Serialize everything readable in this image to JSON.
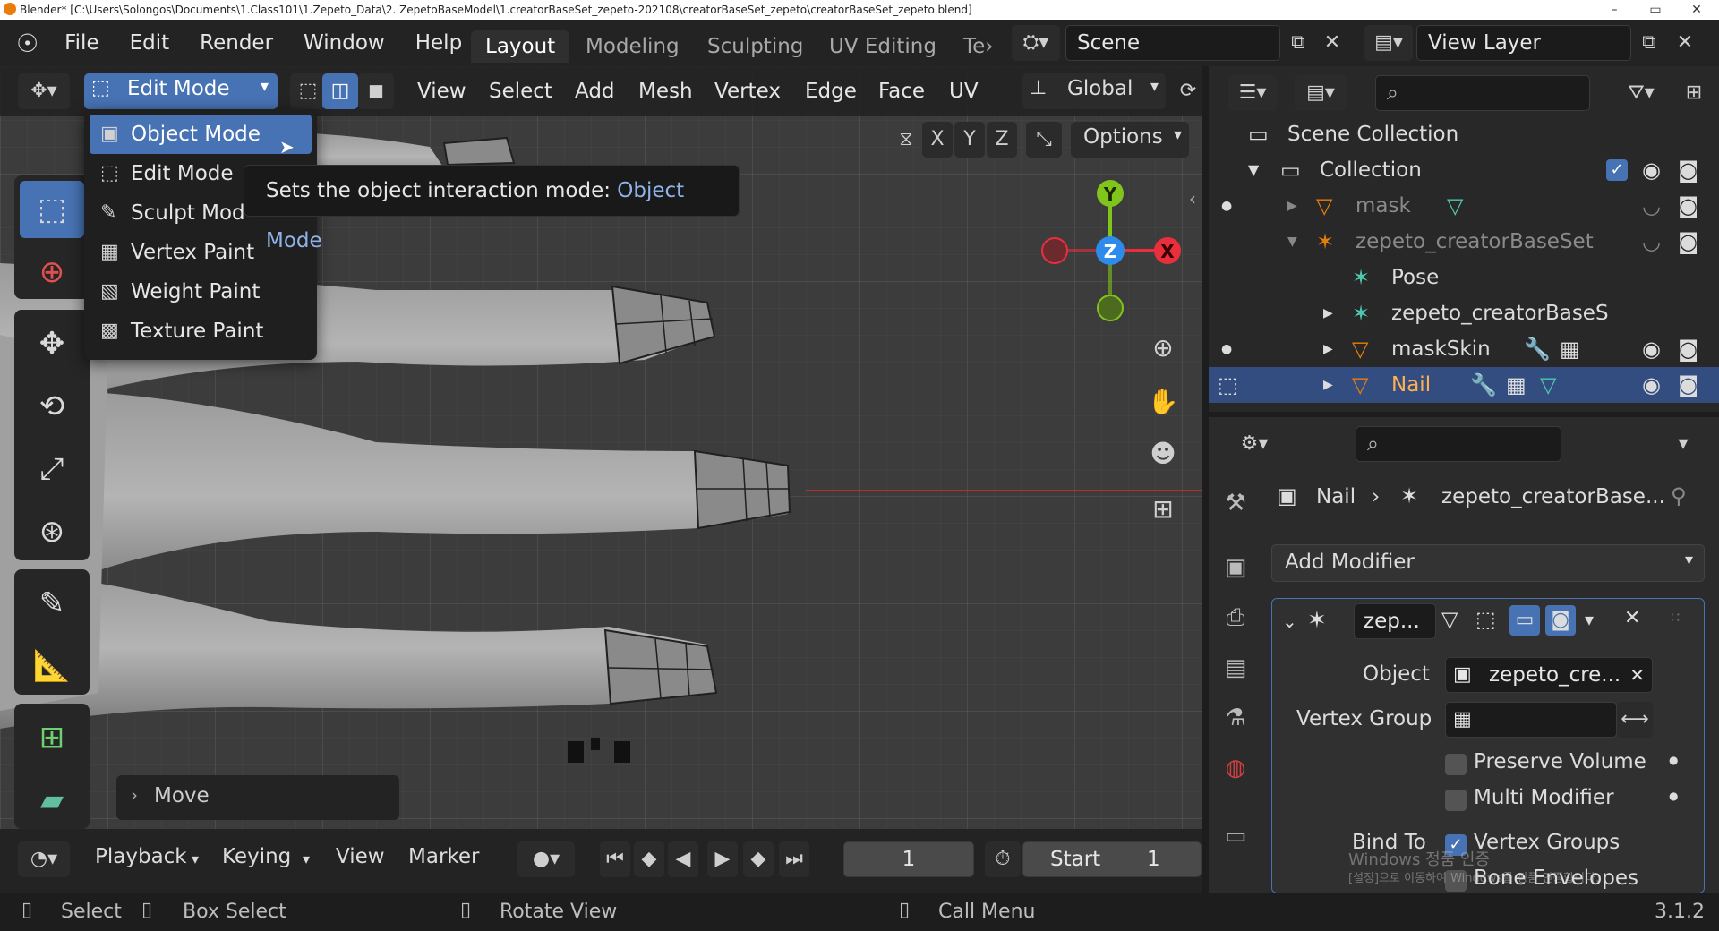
{
  "window": {
    "title": "Blender* [C:\\Users\\Solongos\\Documents\\1.Class101\\1.Zepeto_Data\\2. ZepetoBaseModel\\1.creatorBaseSet_zepeto-202108\\creatorBaseSet_zepeto\\creatorBaseSet_zepeto.blend]",
    "minimize": "–",
    "maximize": "▭",
    "close": "✕"
  },
  "menubar": {
    "items": [
      "File",
      "Edit",
      "Render",
      "Window",
      "Help"
    ]
  },
  "workspaces": {
    "tabs": [
      "Layout",
      "Modeling",
      "Sculpting",
      "UV Editing",
      "Te›"
    ],
    "active": "Layout"
  },
  "scene": {
    "label": "Scene"
  },
  "view_layer": {
    "label": "View Layer"
  },
  "viewport_header": {
    "mode": "Edit Mode",
    "menus": [
      "View",
      "Select",
      "Add",
      "Mesh",
      "Vertex",
      "Edge",
      "Face",
      "UV"
    ],
    "transform_orientation": "Global",
    "axes": [
      "X",
      "Y",
      "Z"
    ],
    "options": "Options"
  },
  "mode_dropdown": {
    "items": [
      {
        "label": "Object Mode",
        "icon": "object-mode-icon",
        "glyph": "▣"
      },
      {
        "label": "Edit Mode",
        "icon": "edit-mode-icon",
        "glyph": "⬚"
      },
      {
        "label": "Sculpt Mod",
        "icon": "sculpt-mode-icon",
        "glyph": "✎"
      },
      {
        "label": "Vertex Paint",
        "icon": "vertex-paint-icon",
        "glyph": "▦"
      },
      {
        "label": "Weight Paint",
        "icon": "weight-paint-icon",
        "glyph": "▧"
      },
      {
        "label": "Texture Paint",
        "icon": "texture-paint-icon",
        "glyph": "▩"
      }
    ]
  },
  "tooltip": {
    "text": "Sets the object interaction mode: ",
    "value": "Object Mode"
  },
  "gizmo": {
    "y": "Y",
    "z": "Z",
    "x": "X"
  },
  "last_operator": {
    "label": "Move"
  },
  "timeline": {
    "menus": [
      "Playback",
      "Keying",
      "View",
      "Marker"
    ],
    "frame": "1",
    "start_label": "Start",
    "start_value": "1"
  },
  "statusbar": {
    "select": "Select",
    "box_select": "Box Select",
    "rotate_view": "Rotate View",
    "call_menu": "Call Menu",
    "version": "3.1.2"
  },
  "outliner": {
    "scene_collection": "Scene Collection",
    "collection": "Collection",
    "rows": [
      {
        "name": "mask"
      },
      {
        "name": "zepeto_creatorBaseSet"
      },
      {
        "name": "Pose"
      },
      {
        "name": "zepeto_creatorBaseS"
      },
      {
        "name": "maskSkin"
      },
      {
        "name": "Nail"
      }
    ]
  },
  "properties": {
    "breadcrumb_object": "Nail",
    "breadcrumb_data": "zepeto_creatorBase...",
    "add_modifier": "Add Modifier",
    "modifier_name": "zep...",
    "object_label": "Object",
    "object_value": "zepeto_cre...",
    "vertex_group_label": "Vertex Group",
    "preserve_volume": "Preserve Volume",
    "multi_modifier": "Multi Modifier",
    "bind_to": "Bind To",
    "vertex_groups": "Vertex Groups",
    "bone_envelopes": "Bone Envelopes"
  },
  "watermark": {
    "line1": "Windows 정품 인증",
    "line2": "[설정]으로 이동하여 Windows를 정품 인증합니다."
  },
  "colors": {
    "accent": "#4772b3",
    "x_axis": "#e8303c",
    "y_axis": "#80c41c",
    "z_axis": "#2d8ceb",
    "selected_row": "#334d80"
  }
}
